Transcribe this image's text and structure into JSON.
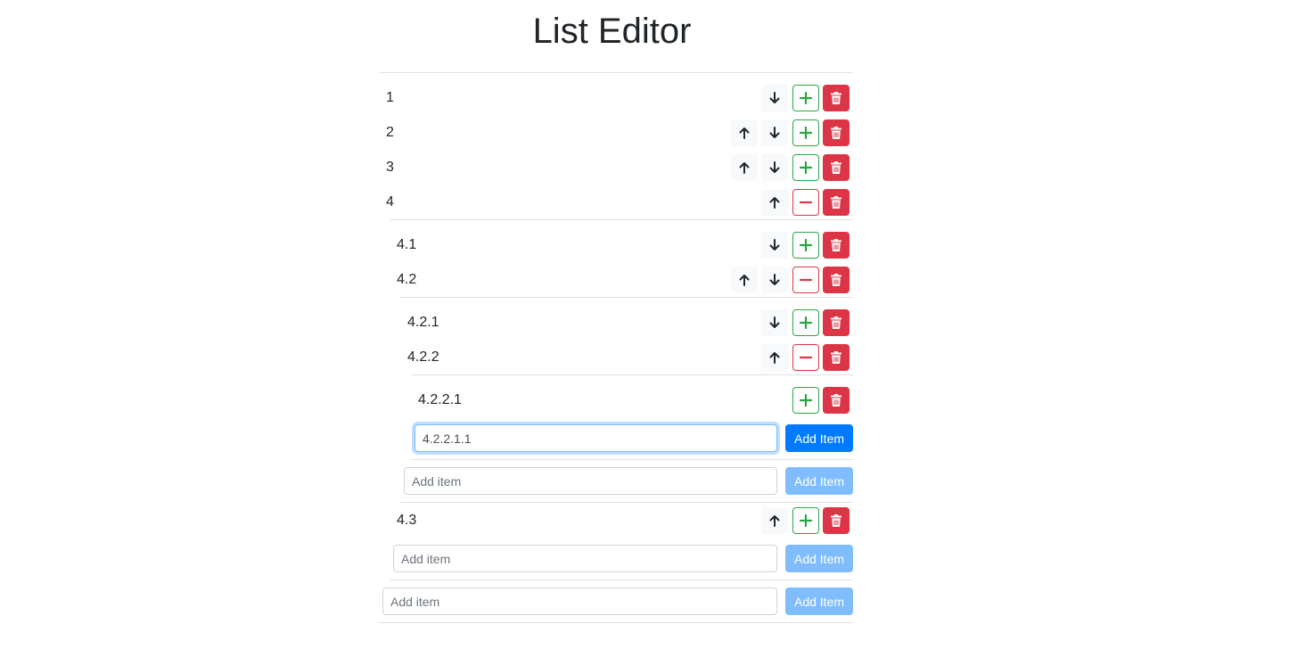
{
  "title": "List Editor",
  "colors": {
    "primary": "#007bff",
    "primary_disabled": "#80bdff",
    "success": "#28a745",
    "danger": "#dc3545",
    "light": "#f8f9fa",
    "divider": "#dee2e6"
  },
  "icons": {
    "up": "arrow-up-icon",
    "down": "arrow-down-icon",
    "expand": "plus-icon",
    "collapse": "minus-icon",
    "delete": "trash-icon"
  },
  "items": {
    "i1": "1",
    "i2": "2",
    "i3": "3",
    "i4": "4",
    "i4_1": "4.1",
    "i4_2": "4.2",
    "i4_2_1": "4.2.1",
    "i4_2_2": "4.2.2",
    "i4_2_2_1": "4.2.2.1",
    "i4_3": "4.3"
  },
  "add_forms": {
    "level4_value": "4.2.2.1.1",
    "placeholder": "Add item",
    "button_label": "Add Item"
  }
}
